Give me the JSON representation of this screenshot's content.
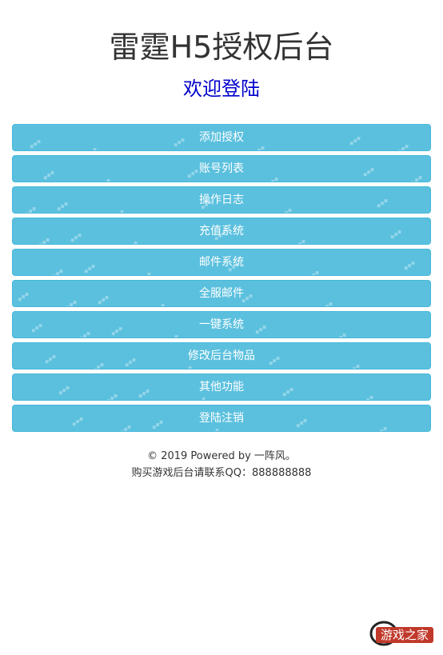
{
  "header": {
    "title": "雷霆H5授权后台",
    "subtitle": "欢迎登陆"
  },
  "menu": {
    "items": [
      {
        "label": "添加授权"
      },
      {
        "label": "账号列表"
      },
      {
        "label": "操作日志"
      },
      {
        "label": "充值系统"
      },
      {
        "label": "邮件系统"
      },
      {
        "label": "全服邮件"
      },
      {
        "label": "一键系统"
      },
      {
        "label": "修改后台物品"
      },
      {
        "label": "其他功能"
      },
      {
        "label": "登陆注销"
      }
    ]
  },
  "footer": {
    "copyright": "© 2019 Powered by 一阵风。",
    "contact": "购买游戏后台请联系QQ：888888888"
  },
  "logo": {
    "text": "游戏之家"
  },
  "colors": {
    "button_bg": "#5bc0de",
    "button_border": "#46b8da",
    "subtitle": "#0000cc"
  }
}
